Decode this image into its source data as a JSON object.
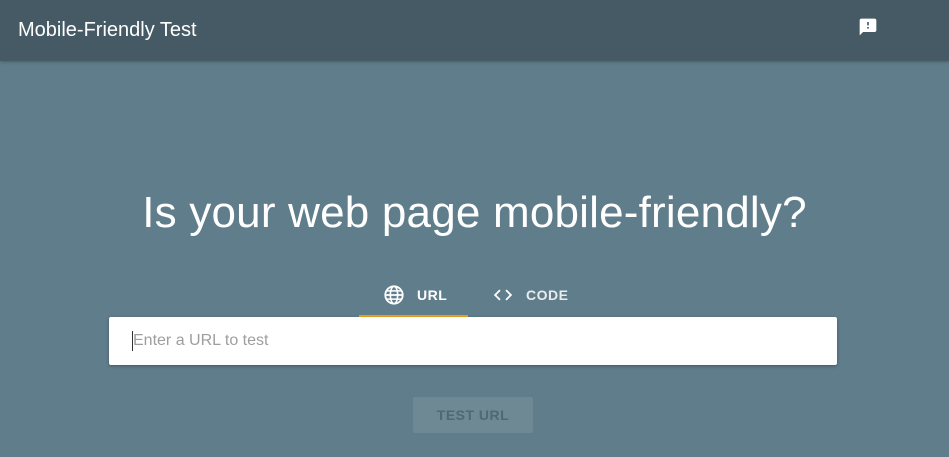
{
  "app_bar": {
    "title": "Mobile-Friendly Test",
    "feedback_icon": "feedback-icon"
  },
  "hero": {
    "heading": "Is your web page mobile-friendly?"
  },
  "tabs": [
    {
      "label": "URL",
      "icon": "globe-icon",
      "active": true
    },
    {
      "label": "CODE",
      "icon": "code-icon",
      "active": false
    }
  ],
  "url_input": {
    "value": "",
    "placeholder": "Enter a URL to test"
  },
  "test_button": {
    "label": "TEST URL",
    "enabled": false
  },
  "colors": {
    "background": "#607d8b",
    "app_bar": "#455a64",
    "tab_indicator": "#f4a01c",
    "button_disabled_bg": "#6e8894",
    "button_disabled_text": "#4f6873"
  }
}
